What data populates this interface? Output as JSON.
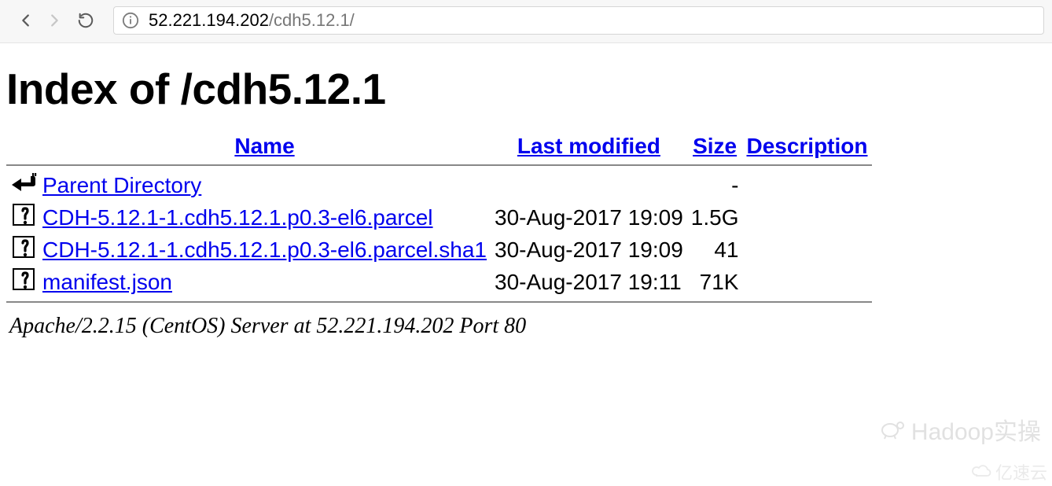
{
  "browser": {
    "url_host": "52.221.194.202",
    "url_path": "/cdh5.12.1/"
  },
  "page": {
    "title": "Index of /cdh5.12.1"
  },
  "columns": {
    "name": "Name",
    "last_modified": "Last modified",
    "size": "Size",
    "description": "Description"
  },
  "rows": [
    {
      "icon": "back",
      "name": "Parent Directory",
      "last_modified": "",
      "size": "-",
      "description": ""
    },
    {
      "icon": "unknown",
      "name": "CDH-5.12.1-1.cdh5.12.1.p0.3-el6.parcel",
      "last_modified": "30-Aug-2017 19:09",
      "size": "1.5G",
      "description": ""
    },
    {
      "icon": "unknown",
      "name": "CDH-5.12.1-1.cdh5.12.1.p0.3-el6.parcel.sha1",
      "last_modified": "30-Aug-2017 19:09",
      "size": "41",
      "description": ""
    },
    {
      "icon": "unknown",
      "name": "manifest.json",
      "last_modified": "30-Aug-2017 19:11",
      "size": "71K",
      "description": ""
    }
  ],
  "server_line": "Apache/2.2.15 (CentOS) Server at 52.221.194.202 Port 80",
  "watermarks": {
    "hadoop": "Hadoop实操",
    "yisu": "亿速云"
  }
}
